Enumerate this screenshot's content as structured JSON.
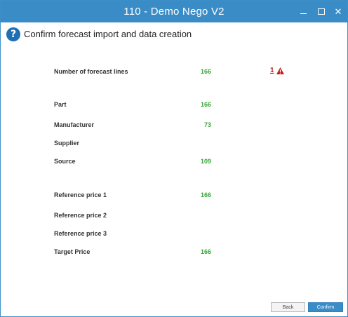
{
  "window": {
    "title": "110 - Demo Nego V2"
  },
  "header": {
    "title": "Confirm forecast import and data creation"
  },
  "rows": [
    {
      "label": "Number of forecast lines",
      "value": "166",
      "warning_count": "1"
    },
    {
      "label": "Part",
      "value": "166"
    },
    {
      "label": "Manufacturer",
      "value": "73"
    },
    {
      "label": "Supplier",
      "value": ""
    },
    {
      "label": "Source",
      "value": "109"
    },
    {
      "label": "Reference price 1",
      "value": "166"
    },
    {
      "label": "Reference price 2",
      "value": ""
    },
    {
      "label": "Reference price 3",
      "value": ""
    },
    {
      "label": "Target Price",
      "value": "166"
    }
  ],
  "buttons": {
    "back": "Back",
    "confirm": "Confirm"
  },
  "colors": {
    "titlebar": "#3a8cc7",
    "value_green": "#3aa43a",
    "warning_red": "#c51b1b",
    "help_icon": "#1f6fb3"
  },
  "icons": {
    "minimize": "minimize-icon",
    "maximize": "maximize-icon",
    "close": "close-icon",
    "help": "question-icon",
    "warning": "warning-triangle-icon"
  }
}
